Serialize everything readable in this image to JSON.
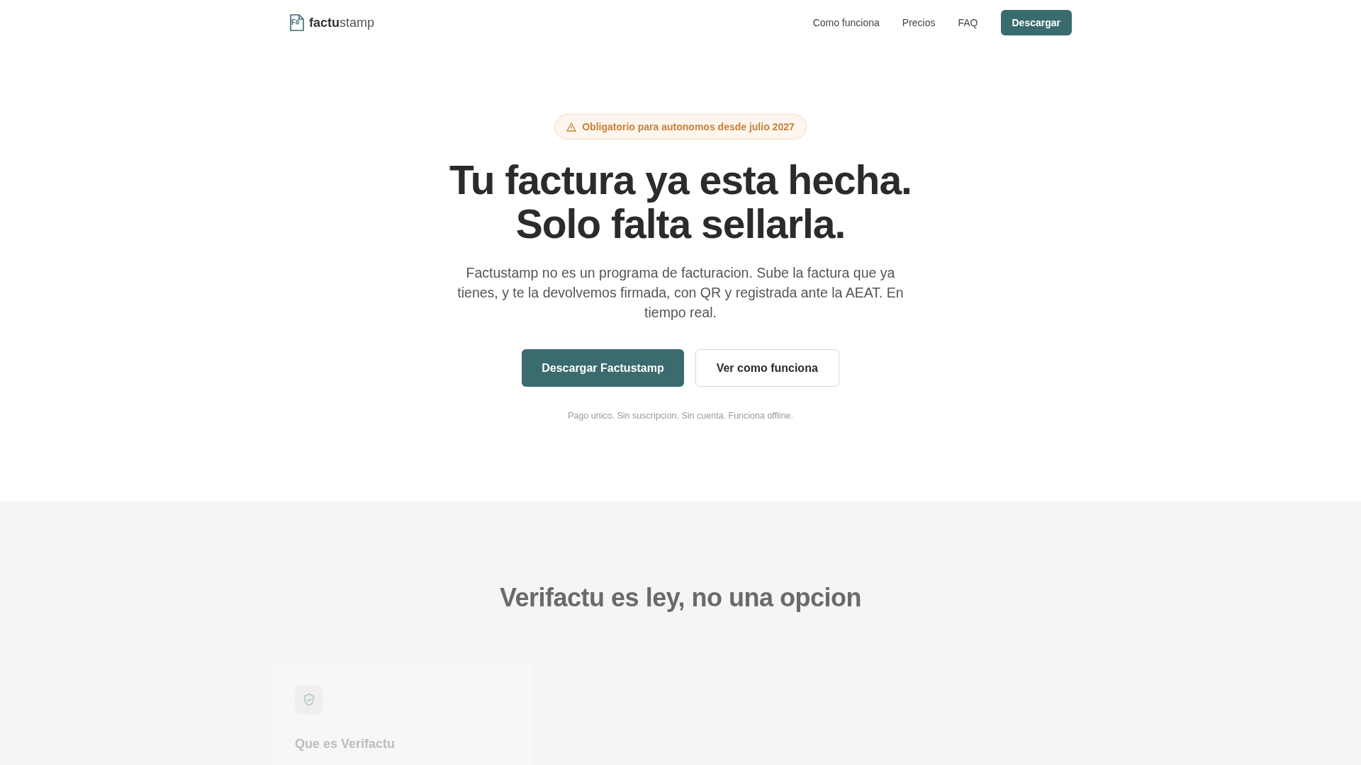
{
  "header": {
    "logo": {
      "mark": "F#",
      "bold": "factu",
      "light": "stamp"
    },
    "nav": [
      "Como funciona",
      "Precios",
      "FAQ"
    ],
    "cta": "Descargar"
  },
  "hero": {
    "badge": "Obligatorio para autonomos desde julio 2027",
    "title_lines": [
      "Tu factura ya esta hecha.",
      "Solo falta sellarla."
    ],
    "subtitle": "Factustamp no es un programa de facturacion. Sube la factura que ya tienes, y te la devolvemos firmada, con QR y registrada ante la AEAT. En tiempo real.",
    "buttons": [
      {
        "label": "Descargar Factustamp",
        "kind": "primary"
      },
      {
        "label": "Ver como funciona",
        "kind": "secondary"
      }
    ],
    "note": "Pago unico. Sin suscripcion. Sin cuenta. Funciona offline."
  },
  "section": {
    "title": "Verifactu es ley, no una opcion",
    "cards": [
      {
        "title": "Que es Verifactu"
      }
    ]
  }
}
